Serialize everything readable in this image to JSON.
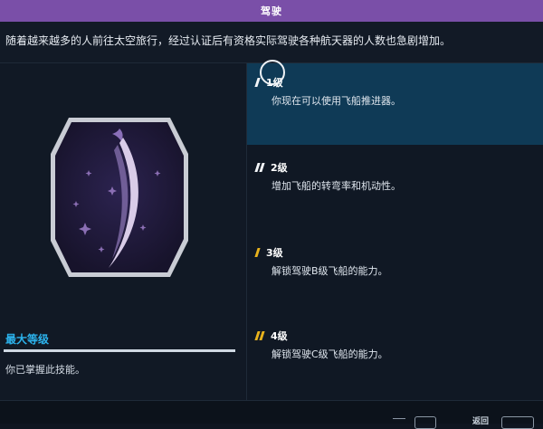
{
  "window": {
    "title": "驾驶"
  },
  "description": "随着越来越多的人前往太空旅行，经过认证后有资格实际驾驶各种航天器的人数也急剧增加。",
  "max_level": {
    "title": "最大等级",
    "desc": "你已掌握此技能。"
  },
  "levels": [
    {
      "title": "1级",
      "desc": "你现在可以使用飞船推进器。",
      "pips": 1
    },
    {
      "title": "2级",
      "desc": "增加飞船的转弯率和机动性。",
      "pips": 2
    },
    {
      "title": "3级",
      "desc": "解锁驾驶B级飞船的能力。",
      "pips": 1
    },
    {
      "title": "4级",
      "desc": "解锁驾驶C级飞船的能力。",
      "pips": 2
    }
  ],
  "footer": {
    "back_label": "返回"
  },
  "colors": {
    "title_bar": "#7a4fa8",
    "accent_blue": "#2cb4ee",
    "selected_row": "#0f3a56",
    "pip_white": "#f2f5f8",
    "pip_gold": "#e8b21c",
    "badge_bg": "#20193a"
  }
}
